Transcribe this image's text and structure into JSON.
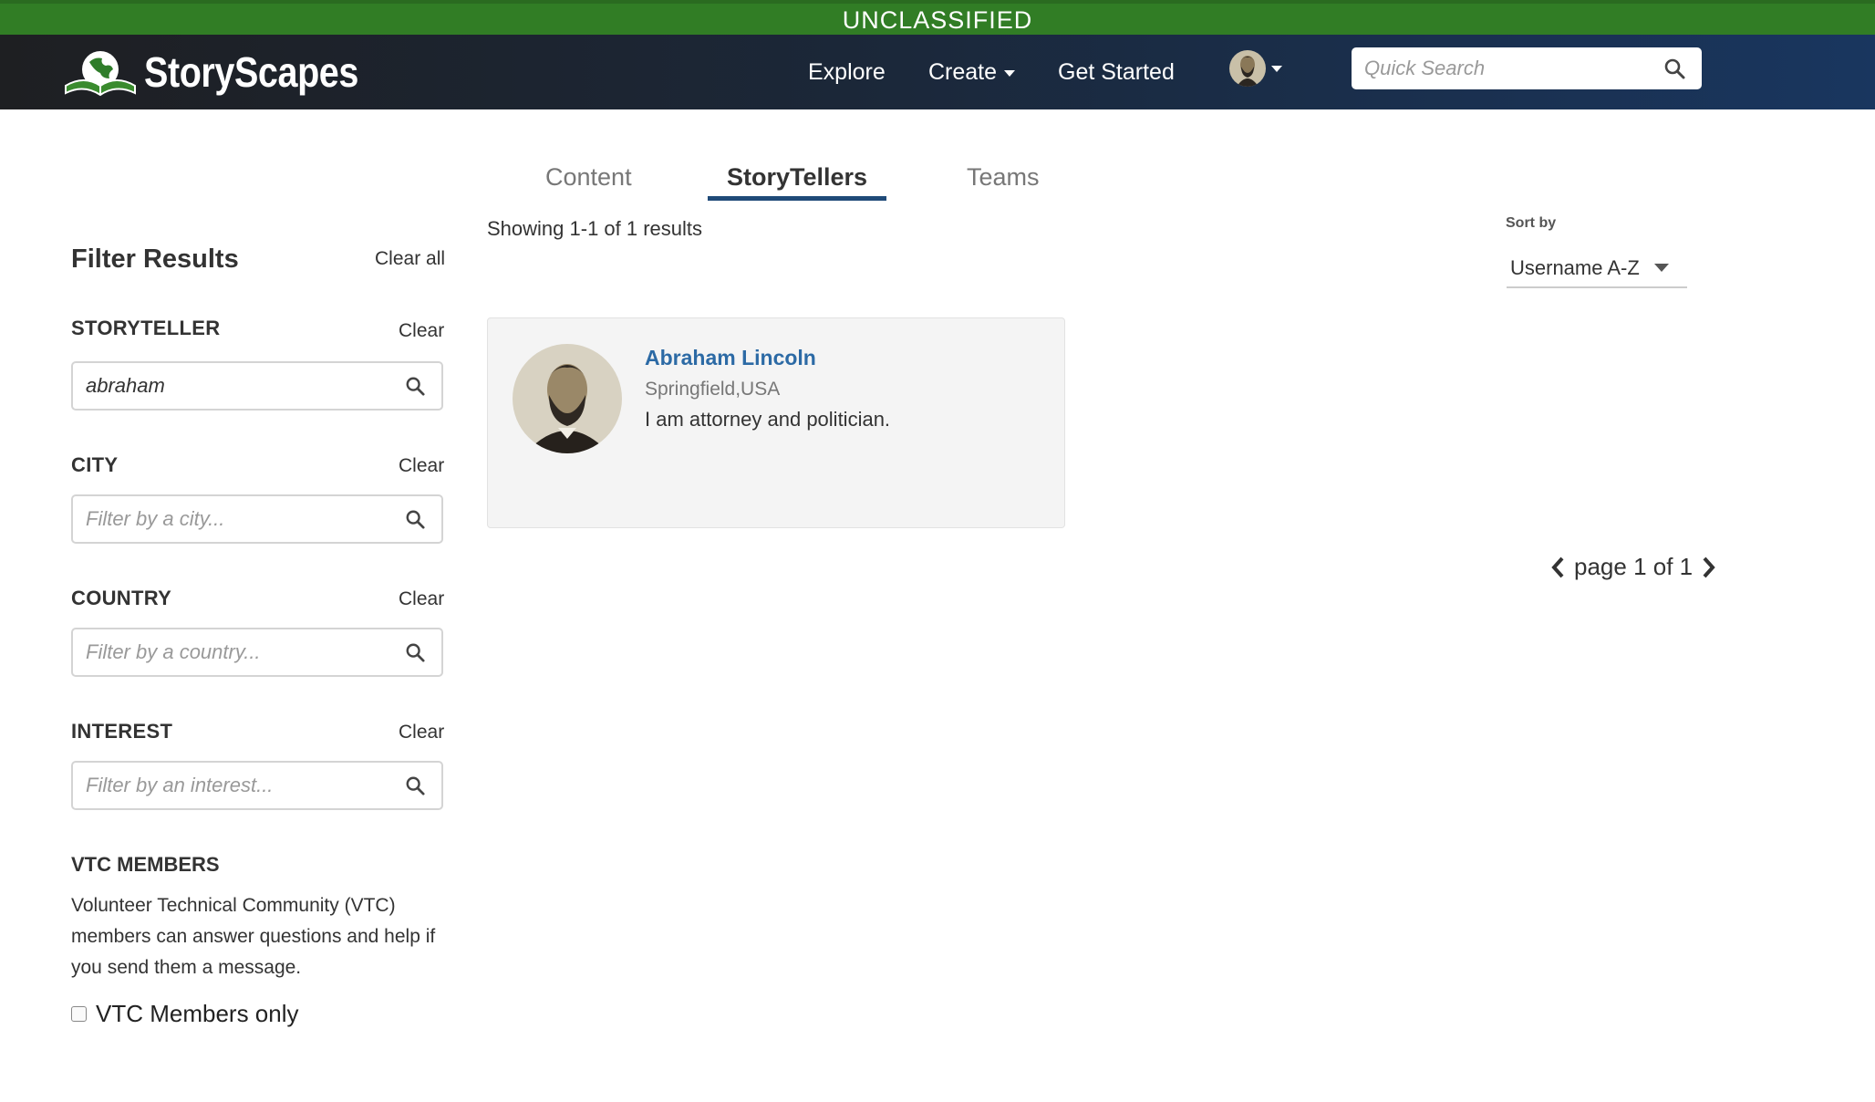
{
  "classification_banner": "UNCLASSIFIED",
  "brand": {
    "name": "StoryScapes",
    "icon": "book-globe-logo"
  },
  "nav": {
    "explore": "Explore",
    "create": "Create",
    "get_started": "Get Started",
    "user_avatar": "user-avatar",
    "search_placeholder": "Quick Search"
  },
  "tabs": [
    {
      "label": "Content",
      "active": false
    },
    {
      "label": "StoryTellers",
      "active": true
    },
    {
      "label": "Teams",
      "active": false
    }
  ],
  "results": {
    "summary": "Showing 1-1 of 1 results"
  },
  "sort": {
    "label": "Sort by",
    "value": "Username A-Z"
  },
  "filters": {
    "title": "Filter Results",
    "clear_all": "Clear all",
    "clear_label": "Clear",
    "storyteller": {
      "label": "STORYTELLER",
      "value": "abraham",
      "placeholder": ""
    },
    "city": {
      "label": "CITY",
      "value": "",
      "placeholder": "Filter by a city..."
    },
    "country": {
      "label": "COUNTRY",
      "value": "",
      "placeholder": "Filter by a country..."
    },
    "interest": {
      "label": "INTEREST",
      "value": "",
      "placeholder": "Filter by an interest..."
    },
    "vtc": {
      "title": "VTC MEMBERS",
      "description": "Volunteer Technical Community (VTC) members can answer questions and help if you send them a message.",
      "checkbox_label": "VTC Members only",
      "checked": false
    }
  },
  "storytellers": [
    {
      "name": "Abraham Lincoln",
      "location": "Springfield,USA",
      "bio": "I am attorney and politician."
    }
  ],
  "pagination": {
    "text": "page 1 of 1"
  },
  "colors": {
    "banner_green": "#317d25",
    "nav_dark": "#1e1f22",
    "nav_blue": "#19365f",
    "link_blue": "#2c6aa5",
    "tab_underline": "#1f4a78"
  }
}
